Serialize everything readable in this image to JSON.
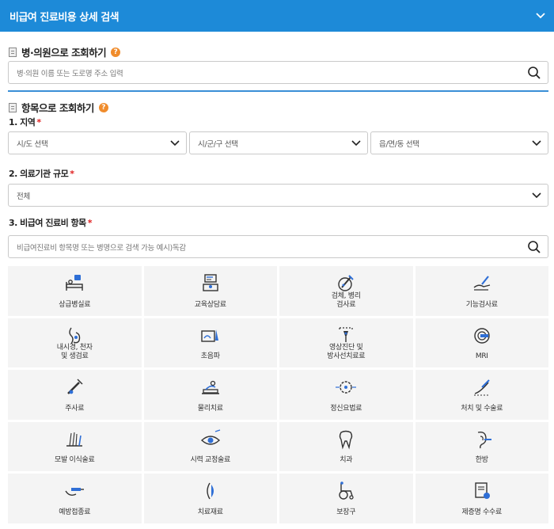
{
  "header": {
    "title": "비급여 진료비용 상세 검색"
  },
  "hospital_search": {
    "title": "병·의원으로 조회하기",
    "help": "?",
    "placeholder": "병·의원 이름 또는 도로명 주소 입력"
  },
  "item_search": {
    "title": "항목으로 조회하기",
    "help": "?",
    "region": {
      "label": "1. 지역",
      "required": "*",
      "selects": [
        "시/도 선택",
        "시/군/구 선택",
        "읍/면/동 선택"
      ]
    },
    "scale": {
      "label": "2. 의료기관 규모",
      "required": "*",
      "value": "전체"
    },
    "items": {
      "label": "3. 비급여 진료비 항목",
      "required": "*",
      "placeholder": "비급여진료비 항목명 또는 병명으로 검색 가능 예시)독감"
    },
    "categories": [
      {
        "label": "상급병실료",
        "icon": "hospital-bed-icon"
      },
      {
        "label": "교육상담료",
        "icon": "counseling-icon"
      },
      {
        "label": "검체, 병리\n검사료",
        "icon": "specimen-test-icon"
      },
      {
        "label": "기능검사료",
        "icon": "function-test-icon"
      },
      {
        "label": "내시경, 천자\n및 생검료",
        "icon": "endoscope-icon"
      },
      {
        "label": "초음파",
        "icon": "ultrasound-icon"
      },
      {
        "label": "영상진단 및\n방사선치료료",
        "icon": "radiology-icon"
      },
      {
        "label": "MRI",
        "icon": "mri-icon"
      },
      {
        "label": "주사료",
        "icon": "syringe-icon"
      },
      {
        "label": "물리치료",
        "icon": "physical-therapy-icon"
      },
      {
        "label": "정신요법료",
        "icon": "brain-icon"
      },
      {
        "label": "처치 및 수술료",
        "icon": "surgery-icon"
      },
      {
        "label": "모발 이식술료",
        "icon": "hair-transplant-icon"
      },
      {
        "label": "시력 교정술료",
        "icon": "eye-icon"
      },
      {
        "label": "치과",
        "icon": "tooth-icon"
      },
      {
        "label": "한방",
        "icon": "ear-acupuncture-icon"
      },
      {
        "label": "예방접종료",
        "icon": "vaccine-icon"
      },
      {
        "label": "치료재료",
        "icon": "treatment-material-icon"
      },
      {
        "label": "보장구",
        "icon": "wheelchair-icon"
      },
      {
        "label": "제증명 수수료",
        "icon": "certificate-icon"
      }
    ]
  }
}
